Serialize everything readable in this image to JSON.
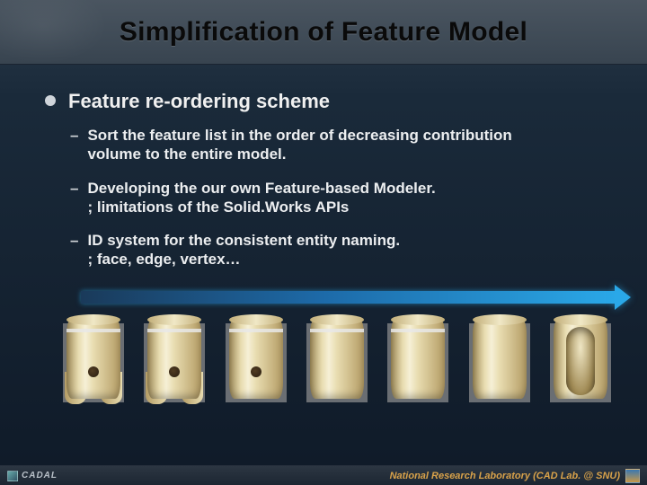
{
  "title": "Simplification of Feature Model",
  "section_heading": "Feature re-ordering scheme",
  "bullets": [
    {
      "line1": "Sort the feature list in the order of decreasing contribution",
      "line2": "volume to the entire model."
    },
    {
      "line1": "Developing the our own Feature-based Modeler.",
      "line2": "; limitations of the Solid.Works APIs"
    },
    {
      "line1": "ID system for the consistent entity naming.",
      "line2": "; face, edge, vertex…"
    }
  ],
  "footer": {
    "left_brand": "CADAL",
    "right_text": "National Research Laboratory (CAD Lab. @ SNU)"
  }
}
